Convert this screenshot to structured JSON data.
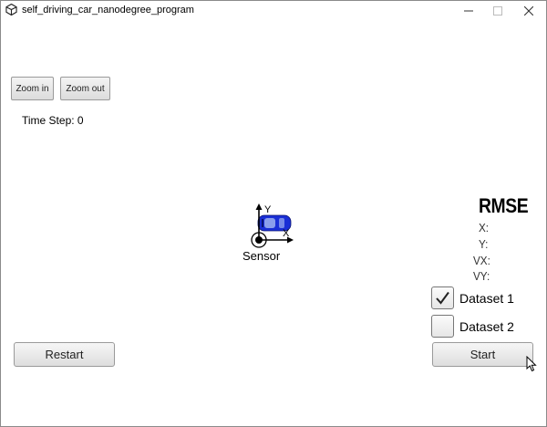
{
  "window": {
    "title": "self_driving_car_nanodegree_program",
    "icons": {
      "app": "unity-logo-icon",
      "minimize": "minimize-icon",
      "maximize": "maximize-icon",
      "close": "close-icon"
    }
  },
  "toolbar": {
    "zoom_in_label": "Zoom in",
    "zoom_out_label": "Zoom out"
  },
  "status": {
    "time_step": "Time Step: 0"
  },
  "scene": {
    "sensor_label": "Sensor",
    "axis_x_label": "X",
    "axis_y_label": "Y",
    "car_color": "#1a2fd6"
  },
  "rmse": {
    "title": "RMSE",
    "x_label": "X:",
    "y_label": "Y:",
    "vx_label": "VX:",
    "vy_label": "VY:"
  },
  "datasets": [
    {
      "label": "Dataset 1",
      "checked": true
    },
    {
      "label": "Dataset 2",
      "checked": false
    }
  ],
  "actions": {
    "restart_label": "Restart",
    "start_label": "Start"
  }
}
